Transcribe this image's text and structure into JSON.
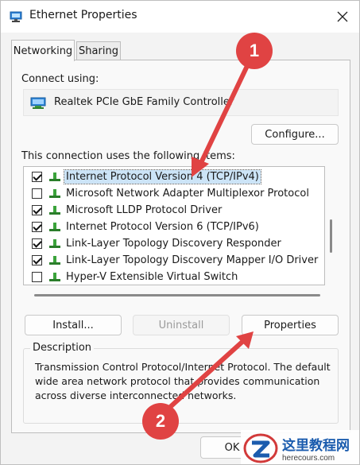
{
  "window": {
    "title": "Ethernet Properties"
  },
  "tabs": [
    {
      "label": "Networking",
      "active": true
    },
    {
      "label": "Sharing",
      "active": false
    }
  ],
  "connect_using": {
    "label": "Connect using:",
    "adapter": "Realtek PCIe GbE Family Controller"
  },
  "buttons": {
    "configure": "Configure...",
    "install": "Install...",
    "uninstall": "Uninstall",
    "properties": "Properties",
    "ok": "OK"
  },
  "items_label": "This connection uses the following items:",
  "items": [
    {
      "label": "Internet Protocol Version 4 (TCP/IPv4)",
      "checked": true,
      "selected": true
    },
    {
      "label": "Microsoft Network Adapter Multiplexor Protocol",
      "checked": false,
      "selected": false
    },
    {
      "label": "Microsoft LLDP Protocol Driver",
      "checked": true,
      "selected": false
    },
    {
      "label": "Internet Protocol Version 6 (TCP/IPv6)",
      "checked": true,
      "selected": false
    },
    {
      "label": "Link-Layer Topology Discovery Responder",
      "checked": true,
      "selected": false
    },
    {
      "label": "Link-Layer Topology Discovery Mapper I/O Driver",
      "checked": true,
      "selected": false
    },
    {
      "label": "Hyper-V Extensible Virtual Switch",
      "checked": false,
      "selected": false
    }
  ],
  "description": {
    "title": "Description",
    "text": "Transmission Control Protocol/Internet Protocol. The default wide area network protocol that provides communication across diverse interconnected networks."
  },
  "annotations": [
    {
      "label": "1"
    },
    {
      "label": "2"
    }
  ],
  "watermark": {
    "cn": "这里教程网",
    "url": "herecours.com"
  },
  "colors": {
    "accent": "#005fb8",
    "selection": "#cce4f7",
    "annotation": "#e04343"
  }
}
